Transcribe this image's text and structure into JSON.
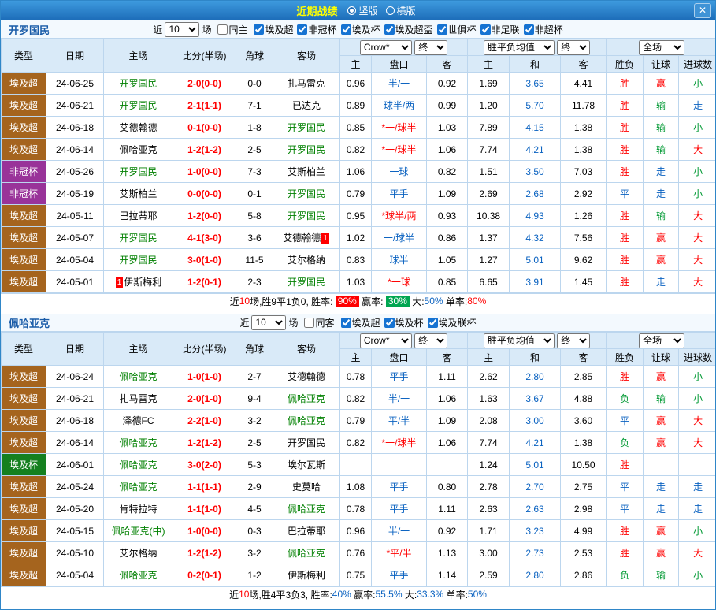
{
  "colors": {
    "topbar_start": "#3e9ade",
    "topbar_end": "#1c6cb8",
    "title_yellow": "#ffff00",
    "header_bg": "#d9eaf8",
    "grid_line": "#bcd6ee",
    "team_blue": "#1a5ca8",
    "highlight_green": "#008000",
    "win_red": "#ff0000",
    "lose_green": "#009933",
    "draw_blue": "#0a62c0",
    "league_super": "#a5641e",
    "league_caf": "#993399",
    "league_cup": "#15801f",
    "badge_red": "#ff0000",
    "badge_green": "#00a651"
  },
  "topbar": {
    "title": "近期战绩",
    "layout_vertical": "竖版",
    "layout_horizontal": "横版",
    "close": "✕"
  },
  "controls": {
    "near": "近",
    "count": "10",
    "matches": "场",
    "odds_source": "Crow*",
    "final": "终",
    "avg_label": "胜平负均值",
    "full": "全场"
  },
  "columns": {
    "type": "类型",
    "date": "日期",
    "home": "主场",
    "score": "比分(半场)",
    "corner": "角球",
    "away": "客场",
    "odds_home": "主",
    "handicap": "盘口",
    "odds_away": "客",
    "avg_home": "主",
    "avg_draw": "和",
    "avg_away": "客",
    "result": "胜负",
    "spread": "让球",
    "goals": "进球数"
  },
  "sections": [
    {
      "team": "开罗国民",
      "same_filter": "同主",
      "leagues": [
        "埃及超",
        "非冠杯",
        "埃及杯",
        "埃及超盃",
        "世俱杯",
        "非足联",
        "非超杯"
      ],
      "rows": [
        {
          "type": "埃及超",
          "date": "24-06-25",
          "home": "开罗国民",
          "home_hl": true,
          "score": "2-0(0-0)",
          "corner": "0-0",
          "away": "扎马雷克",
          "odds_home": "0.96",
          "handicap": "半/一",
          "odds_away": "0.92",
          "avg_home": "1.69",
          "avg_draw": "3.65",
          "avg_away": "4.41",
          "result": "胜",
          "spread": "赢",
          "goals": "小"
        },
        {
          "type": "埃及超",
          "date": "24-06-21",
          "home": "开罗国民",
          "home_hl": true,
          "score": "2-1(1-1)",
          "corner": "7-1",
          "away": "已达克",
          "odds_home": "0.89",
          "handicap": "球半/两",
          "odds_away": "0.99",
          "avg_home": "1.20",
          "avg_draw": "5.70",
          "avg_away": "11.78",
          "result": "胜",
          "spread": "输",
          "goals": "走"
        },
        {
          "type": "埃及超",
          "date": "24-06-18",
          "home": "艾德翰德",
          "score": "0-1(0-0)",
          "corner": "1-8",
          "away": "开罗国民",
          "away_hl": true,
          "odds_home": "0.85",
          "handicap": "*一/球半",
          "odds_away": "1.03",
          "avg_home": "7.89",
          "avg_draw": "4.15",
          "avg_away": "1.38",
          "result": "胜",
          "spread": "输",
          "goals": "小"
        },
        {
          "type": "埃及超",
          "date": "24-06-14",
          "home": "佩哈亚克",
          "score": "1-2(1-2)",
          "corner": "2-5",
          "away": "开罗国民",
          "away_hl": true,
          "odds_home": "0.82",
          "handicap": "*一/球半",
          "odds_away": "1.06",
          "avg_home": "7.74",
          "avg_draw": "4.21",
          "avg_away": "1.38",
          "result": "胜",
          "spread": "输",
          "goals": "大"
        },
        {
          "type": "非冠杯",
          "date": "24-05-26",
          "home": "开罗国民",
          "home_hl": true,
          "score": "1-0(0-0)",
          "corner": "7-3",
          "away": "艾斯柏兰",
          "odds_home": "1.06",
          "handicap": "一球",
          "odds_away": "0.82",
          "avg_home": "1.51",
          "avg_draw": "3.50",
          "avg_away": "7.03",
          "result": "胜",
          "spread": "走",
          "goals": "小"
        },
        {
          "type": "非冠杯",
          "date": "24-05-19",
          "home": "艾斯柏兰",
          "score": "0-0(0-0)",
          "corner": "0-1",
          "away": "开罗国民",
          "away_hl": true,
          "odds_home": "0.79",
          "handicap": "平手",
          "odds_away": "1.09",
          "avg_home": "2.69",
          "avg_draw": "2.68",
          "avg_away": "2.92",
          "result": "平",
          "spread": "走",
          "goals": "小"
        },
        {
          "type": "埃及超",
          "date": "24-05-11",
          "home": "巴拉蒂耶",
          "score": "1-2(0-0)",
          "corner": "5-8",
          "away": "开罗国民",
          "away_hl": true,
          "odds_home": "0.95",
          "handicap": "*球半/两",
          "odds_away": "0.93",
          "avg_home": "10.38",
          "avg_draw": "4.93",
          "avg_away": "1.26",
          "result": "胜",
          "spread": "输",
          "goals": "大"
        },
        {
          "type": "埃及超",
          "date": "24-05-07",
          "home": "开罗国民",
          "home_hl": true,
          "score": "4-1(3-0)",
          "corner": "3-6",
          "away": "艾德翰德",
          "away_badge": "1",
          "odds_home": "1.02",
          "handicap": "一/球半",
          "odds_away": "0.86",
          "avg_home": "1.37",
          "avg_draw": "4.32",
          "avg_away": "7.56",
          "result": "胜",
          "spread": "赢",
          "goals": "大"
        },
        {
          "type": "埃及超",
          "date": "24-05-04",
          "home": "开罗国民",
          "home_hl": true,
          "score": "3-0(1-0)",
          "corner": "11-5",
          "away": "艾尔格纳",
          "odds_home": "0.83",
          "handicap": "球半",
          "odds_away": "1.05",
          "avg_home": "1.27",
          "avg_draw": "5.01",
          "avg_away": "9.62",
          "result": "胜",
          "spread": "赢",
          "goals": "大"
        },
        {
          "type": "埃及超",
          "date": "24-05-01",
          "home": "伊斯梅利",
          "home_badge": "1",
          "score": "1-2(0-1)",
          "corner": "2-3",
          "away": "开罗国民",
          "away_hl": true,
          "odds_home": "1.03",
          "handicap": "*一球",
          "odds_away": "0.85",
          "avg_home": "6.65",
          "avg_draw": "3.91",
          "avg_away": "1.45",
          "result": "胜",
          "spread": "走",
          "goals": "大"
        }
      ],
      "summary": [
        {
          "t": "近"
        },
        {
          "t": "10",
          "cls": "s-red"
        },
        {
          "t": "场,胜9平1负0, 胜率: "
        },
        {
          "t": "90%",
          "cls": "s-badge-red"
        },
        {
          "t": " 赢率: "
        },
        {
          "t": "30%",
          "cls": "s-badge-green"
        },
        {
          "t": " 大:"
        },
        {
          "t": "50%",
          "cls": "s-blue"
        },
        {
          "t": " 单率:"
        },
        {
          "t": "80%",
          "cls": "s-red"
        }
      ]
    },
    {
      "team": "佩哈亚克",
      "same_filter": "同客",
      "leagues": [
        "埃及超",
        "埃及杯",
        "埃及联杯"
      ],
      "rows": [
        {
          "type": "埃及超",
          "date": "24-06-24",
          "home": "佩哈亚克",
          "home_hl": true,
          "score": "1-0(1-0)",
          "corner": "2-7",
          "away": "艾德翰德",
          "odds_home": "0.78",
          "handicap": "平手",
          "odds_away": "1.11",
          "avg_home": "2.62",
          "avg_draw": "2.80",
          "avg_away": "2.85",
          "result": "胜",
          "spread": "赢",
          "goals": "小"
        },
        {
          "type": "埃及超",
          "date": "24-06-21",
          "home": "扎马雷克",
          "score": "2-0(1-0)",
          "corner": "9-4",
          "away": "佩哈亚克",
          "away_hl": true,
          "odds_home": "0.82",
          "handicap": "半/一",
          "odds_away": "1.06",
          "avg_home": "1.63",
          "avg_draw": "3.67",
          "avg_away": "4.88",
          "result": "负",
          "spread": "输",
          "goals": "小"
        },
        {
          "type": "埃及超",
          "date": "24-06-18",
          "home": "泽德FC",
          "score": "2-2(1-0)",
          "corner": "3-2",
          "away": "佩哈亚克",
          "away_hl": true,
          "odds_home": "0.79",
          "handicap": "平/半",
          "odds_away": "1.09",
          "avg_home": "2.08",
          "avg_draw": "3.00",
          "avg_away": "3.60",
          "result": "平",
          "spread": "赢",
          "goals": "大"
        },
        {
          "type": "埃及超",
          "date": "24-06-14",
          "home": "佩哈亚克",
          "home_hl": true,
          "score": "1-2(1-2)",
          "corner": "2-5",
          "away": "开罗国民",
          "odds_home": "0.82",
          "handicap": "*一/球半",
          "odds_away": "1.06",
          "avg_home": "7.74",
          "avg_draw": "4.21",
          "avg_away": "1.38",
          "result": "负",
          "spread": "赢",
          "goals": "大"
        },
        {
          "type": "埃及杯",
          "date": "24-06-01",
          "home": "佩哈亚克",
          "home_hl": true,
          "score": "3-0(2-0)",
          "corner": "5-3",
          "away": "埃尔瓦斯",
          "avg_home": "1.24",
          "avg_draw": "5.01",
          "avg_away": "10.50",
          "result": "胜"
        },
        {
          "type": "埃及超",
          "date": "24-05-24",
          "home": "佩哈亚克",
          "home_hl": true,
          "score": "1-1(1-1)",
          "corner": "2-9",
          "away": "史莫哈",
          "odds_home": "1.08",
          "handicap": "平手",
          "odds_away": "0.80",
          "avg_home": "2.78",
          "avg_draw": "2.70",
          "avg_away": "2.75",
          "result": "平",
          "spread": "走",
          "goals": "走"
        },
        {
          "type": "埃及超",
          "date": "24-05-20",
          "home": "肯特拉特",
          "score": "1-1(1-0)",
          "corner": "4-5",
          "away": "佩哈亚克",
          "away_hl": true,
          "odds_home": "0.78",
          "handicap": "平手",
          "odds_away": "1.11",
          "avg_home": "2.63",
          "avg_draw": "2.63",
          "avg_away": "2.98",
          "result": "平",
          "spread": "走",
          "goals": "走"
        },
        {
          "type": "埃及超",
          "date": "24-05-15",
          "home": "佩哈亚克(中)",
          "home_hl": true,
          "score": "1-0(0-0)",
          "corner": "0-3",
          "away": "巴拉蒂耶",
          "odds_home": "0.96",
          "handicap": "半/一",
          "odds_away": "0.92",
          "avg_home": "1.71",
          "avg_draw": "3.23",
          "avg_away": "4.99",
          "result": "胜",
          "spread": "赢",
          "goals": "小"
        },
        {
          "type": "埃及超",
          "date": "24-05-10",
          "home": "艾尔格纳",
          "score": "1-2(1-2)",
          "corner": "3-2",
          "away": "佩哈亚克",
          "away_hl": true,
          "odds_home": "0.76",
          "handicap": "*平/半",
          "odds_away": "1.13",
          "avg_home": "3.00",
          "avg_draw": "2.73",
          "avg_away": "2.53",
          "result": "胜",
          "spread": "赢",
          "goals": "大"
        },
        {
          "type": "埃及超",
          "date": "24-05-04",
          "home": "佩哈亚克",
          "home_hl": true,
          "score": "0-2(0-1)",
          "corner": "1-2",
          "away": "伊斯梅利",
          "odds_home": "0.75",
          "handicap": "平手",
          "odds_away": "1.14",
          "avg_home": "2.59",
          "avg_draw": "2.80",
          "avg_away": "2.86",
          "result": "负",
          "spread": "输",
          "goals": "小"
        }
      ],
      "summary": [
        {
          "t": "近"
        },
        {
          "t": "10",
          "cls": "s-red"
        },
        {
          "t": "场,胜4平3负3, 胜率:"
        },
        {
          "t": "40%",
          "cls": "s-blue"
        },
        {
          "t": " 赢率:"
        },
        {
          "t": "55.5%",
          "cls": "s-blue"
        },
        {
          "t": " 大:"
        },
        {
          "t": "33.3%",
          "cls": "s-blue"
        },
        {
          "t": " 单率:"
        },
        {
          "t": "50%",
          "cls": "s-blue"
        }
      ]
    }
  ]
}
